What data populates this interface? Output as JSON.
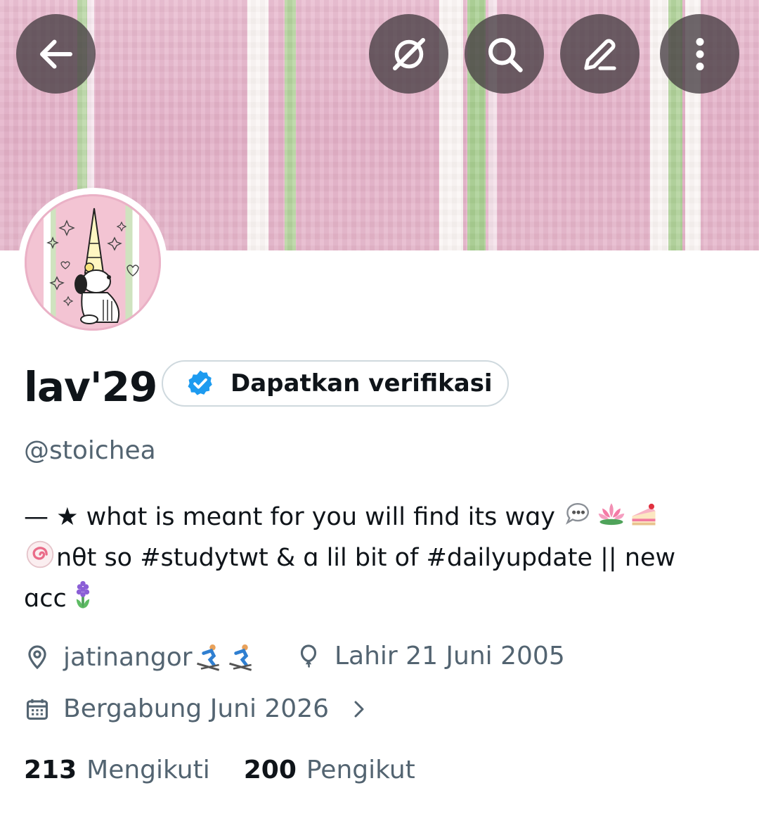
{
  "header": {
    "back_icon": "arrow-left-icon",
    "actions": [
      "grok-icon",
      "search-icon",
      "edit-icon",
      "more-vertical-icon"
    ]
  },
  "profile": {
    "display_name": "lav'29",
    "verify_button_label": "Dapatkan verifikasi",
    "handle": "@stoichea",
    "bio": {
      "line1_text": "— ★ whɑt is meɑnt for you will find its wɑy ",
      "line2_text": "nθt so #studytwt & ɑ lil bit of #dailyupdate || new",
      "line3_text": "ɑcc"
    },
    "location": "jatinangor",
    "birthday": "Lahir 21 Juni 2005",
    "joined": "Bergabung Juni 2026"
  },
  "stats": {
    "following_count": "213",
    "following_label": "Mengikuti",
    "followers_count": "200",
    "followers_label": "Pengikut"
  },
  "colors": {
    "accent": "#1d9bf0",
    "secondary_text": "#536471",
    "banner_pink": "#e6b5ca",
    "banner_green": "#a8cf92"
  }
}
